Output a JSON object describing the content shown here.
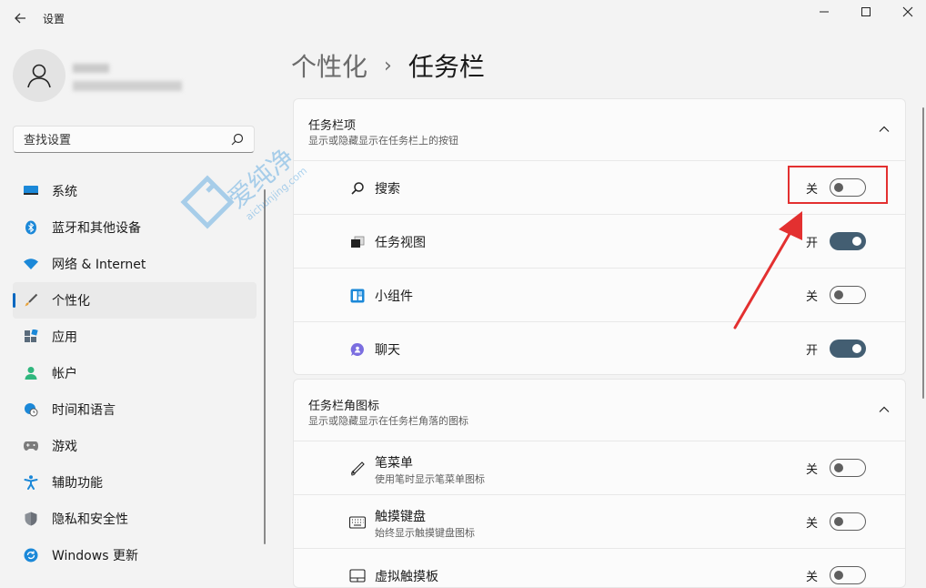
{
  "window": {
    "title": "设置",
    "colors": {
      "accent": "#0067c0",
      "toggle_on": "#435e72",
      "annotation": "#e33030"
    }
  },
  "search": {
    "placeholder": "查找设置"
  },
  "sidebar": {
    "items": [
      {
        "label": "系统",
        "icon": "monitor-icon",
        "active": false
      },
      {
        "label": "蓝牙和其他设备",
        "icon": "bluetooth-icon",
        "active": false
      },
      {
        "label": "网络 & Internet",
        "icon": "wifi-icon",
        "active": false
      },
      {
        "label": "个性化",
        "icon": "brush-icon",
        "active": true
      },
      {
        "label": "应用",
        "icon": "apps-icon",
        "active": false
      },
      {
        "label": "帐户",
        "icon": "account-icon",
        "active": false
      },
      {
        "label": "时间和语言",
        "icon": "globe-clock-icon",
        "active": false
      },
      {
        "label": "游戏",
        "icon": "gamepad-icon",
        "active": false
      },
      {
        "label": "辅助功能",
        "icon": "accessibility-icon",
        "active": false
      },
      {
        "label": "隐私和安全性",
        "icon": "shield-icon",
        "active": false
      },
      {
        "label": "Windows 更新",
        "icon": "update-icon",
        "active": false
      }
    ]
  },
  "breadcrumb": {
    "parent": "个性化",
    "separator": "›",
    "current": "任务栏"
  },
  "sections": [
    {
      "title": "任务栏项",
      "subtitle": "显示或隐藏显示在任务栏上的按钮",
      "items": [
        {
          "label": "搜索",
          "icon": "search-icon",
          "state_label": "关",
          "on": false
        },
        {
          "label": "任务视图",
          "icon": "task-view-icon",
          "state_label": "开",
          "on": true
        },
        {
          "label": "小组件",
          "icon": "widgets-icon",
          "state_label": "关",
          "on": false
        },
        {
          "label": "聊天",
          "icon": "chat-icon",
          "state_label": "开",
          "on": true
        }
      ]
    },
    {
      "title": "任务栏角图标",
      "subtitle": "显示或隐藏显示在任务栏角落的图标",
      "items": [
        {
          "label": "笔菜单",
          "sub": "使用笔时显示笔菜单图标",
          "icon": "pen-icon",
          "state_label": "关",
          "on": false
        },
        {
          "label": "触摸键盘",
          "sub": "始终显示触摸键盘图标",
          "icon": "keyboard-icon",
          "state_label": "关",
          "on": false
        },
        {
          "label": "虚拟触摸板",
          "icon": "touchpad-icon",
          "state_label": "关",
          "on": false
        }
      ]
    }
  ],
  "watermark": {
    "text": "爱纯净",
    "subtext": "aichunjing.com"
  }
}
